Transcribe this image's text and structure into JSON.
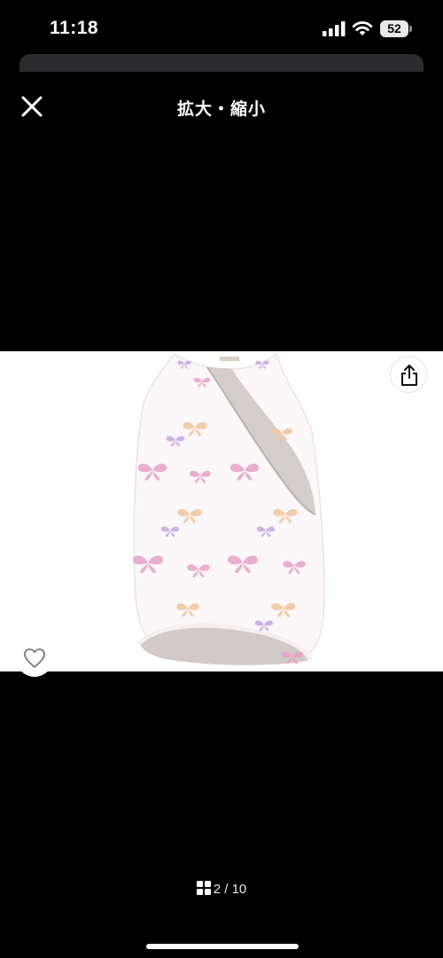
{
  "status_bar": {
    "time": "11:18",
    "battery_level": "52",
    "icons": [
      "signal-icon",
      "wifi-icon",
      "battery-icon"
    ]
  },
  "header": {
    "title": "拡大・縮小",
    "close_icon": "close-icon"
  },
  "product_image": {
    "icon": "sleep-sack-photo",
    "background_color": "#ffffff",
    "garment_color": "#fcf7f8",
    "lining_color": "#cfc9c8",
    "butterfly_colors": [
      "#e8a3c6",
      "#c4a8e6",
      "#f1c8a1"
    ]
  },
  "actions": {
    "share_icon": "share-icon",
    "like_icon": "heart-icon"
  },
  "pagination": {
    "icon": "grid-icon",
    "current": "2",
    "total": "10",
    "label": "2 / 10"
  }
}
